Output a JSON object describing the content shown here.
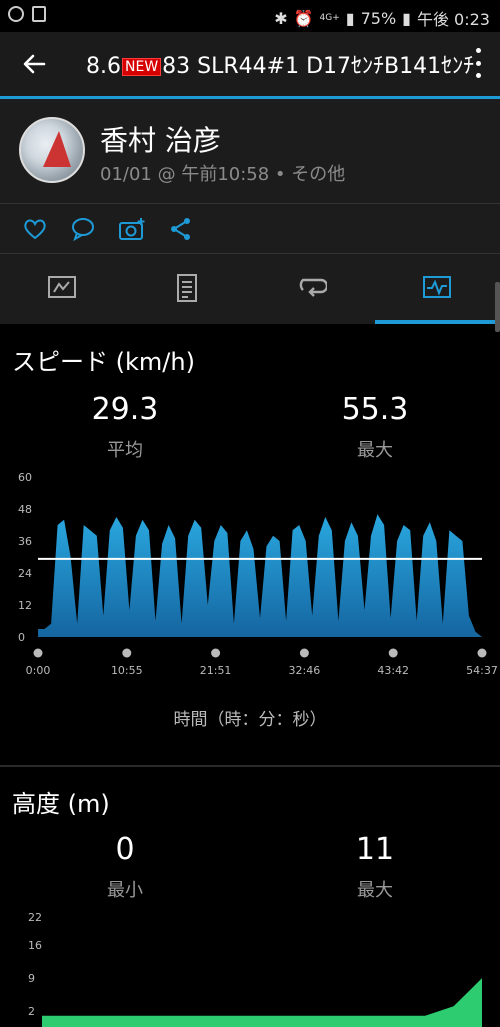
{
  "status_bar": {
    "battery": "75%",
    "time": "午後 0:23",
    "network": "4G+"
  },
  "app_bar": {
    "title_pre": "8.6",
    "title_badge": "NEW",
    "title_post": "83 SLR44#1 D17ｾﾝﾁB141ｾﾝﾁ",
    "back_icon": "back-arrow-icon",
    "more_icon": "more-vert-icon"
  },
  "profile": {
    "name": "香村 治彦",
    "meta": "01/01 @ 午前10:58 • その他"
  },
  "actions": [
    "like-icon",
    "comment-icon",
    "add-photo-icon",
    "share-icon"
  ],
  "tabs": [
    {
      "name": "overview",
      "icon": "overview-icon"
    },
    {
      "name": "details",
      "icon": "details-icon"
    },
    {
      "name": "laps",
      "icon": "laps-icon"
    },
    {
      "name": "charts",
      "icon": "charts-icon",
      "active": true
    }
  ],
  "colors": {
    "accent": "#1e9ad6",
    "speed_fill": "#1a8fc4",
    "elevation_fill": "#2ecc71"
  },
  "speed": {
    "title": "スピード (km/h)",
    "avg_value": "29.3",
    "avg_label": "平均",
    "max_value": "55.3",
    "max_label": "最大"
  },
  "elevation": {
    "title": "高度 (m)",
    "min_value": "0",
    "min_label": "最小",
    "max_value": "11",
    "max_label": "最大"
  },
  "x_axis_title": "時間（時：分：秒）",
  "chart_data": [
    {
      "type": "area",
      "y_ticks": [
        "60",
        "48",
        "36",
        "24",
        "12",
        "0"
      ],
      "ylim": [
        0,
        60
      ],
      "x_ticks": [
        "0:00",
        "10:55",
        "21:51",
        "32:46",
        "43:42",
        "54:37"
      ],
      "average_line": 29.3,
      "series": [
        {
          "values": [
            3,
            3,
            5,
            42,
            44,
            30,
            5,
            42,
            40,
            38,
            8,
            40,
            45,
            41,
            10,
            38,
            44,
            40,
            6,
            35,
            42,
            37,
            5,
            38,
            44,
            41,
            12,
            36,
            42,
            39,
            5,
            36,
            40,
            33,
            7,
            34,
            38,
            36,
            6,
            40,
            42,
            36,
            8,
            38,
            45,
            40,
            6,
            36,
            43,
            38,
            10,
            38,
            46,
            42,
            7,
            36,
            42,
            40,
            6,
            38,
            43,
            36,
            5,
            40,
            38,
            36,
            8,
            2,
            0
          ]
        }
      ]
    },
    {
      "type": "area",
      "y_ticks": [
        "22",
        "16",
        "9",
        "2"
      ],
      "ylim": [
        2,
        22
      ],
      "series": [
        {
          "values": [
            1,
            1,
            1,
            1,
            1,
            1,
            1,
            1,
            1,
            1,
            1,
            1,
            1,
            1,
            1,
            1,
            1,
            1,
            1,
            1,
            1,
            1,
            1,
            1,
            1,
            1,
            1,
            1,
            2,
            3,
            6,
            9
          ]
        }
      ]
    }
  ]
}
